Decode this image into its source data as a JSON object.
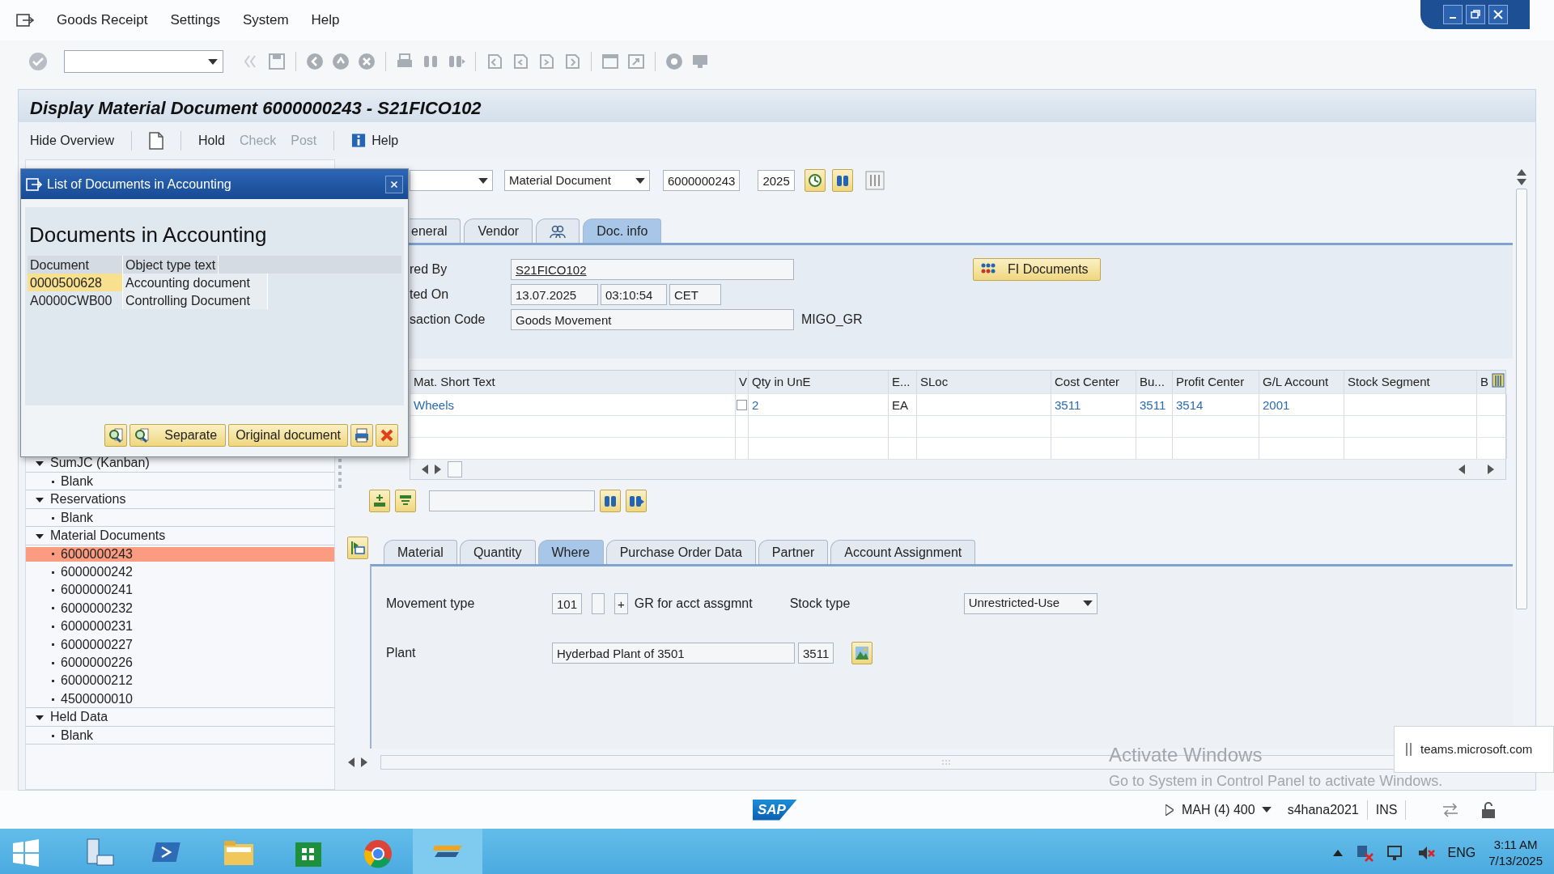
{
  "menu": [
    "Goods Receipt",
    "Settings",
    "System",
    "Help"
  ],
  "title": "Display Material Document 6000000243 - S21FICO102",
  "app_toolbar": [
    {
      "kind": "text",
      "label": "Hide Overview",
      "disabled": false
    },
    {
      "kind": "new_icon"
    },
    {
      "kind": "text",
      "label": "Hold",
      "disabled": false
    },
    {
      "kind": "text",
      "label": "Check",
      "disabled": true
    },
    {
      "kind": "text",
      "label": "Post",
      "disabled": true
    },
    {
      "kind": "info_text",
      "label": "Help",
      "disabled": false
    }
  ],
  "tree": [
    {
      "label": "SumJC (Kanban)",
      "expanded": true,
      "selected": false,
      "children": [
        {
          "label": "Blank",
          "selected": false
        }
      ]
    },
    {
      "label": "Reservations",
      "expanded": true,
      "selected": false,
      "children": [
        {
          "label": "Blank",
          "selected": false
        }
      ]
    },
    {
      "label": "Material Documents",
      "expanded": true,
      "selected": false,
      "children": [
        {
          "label": "6000000243",
          "selected": true
        },
        {
          "label": "6000000242",
          "selected": false
        },
        {
          "label": "6000000241",
          "selected": false
        },
        {
          "label": "6000000232",
          "selected": false
        },
        {
          "label": "6000000231",
          "selected": false
        },
        {
          "label": "6000000227",
          "selected": false
        },
        {
          "label": "6000000226",
          "selected": false
        },
        {
          "label": "6000000212",
          "selected": false
        },
        {
          "label": "4500000010",
          "selected": false
        }
      ]
    },
    {
      "label": "Held Data",
      "expanded": true,
      "selected": false,
      "children": [
        {
          "label": "Blank",
          "selected": false
        }
      ]
    }
  ],
  "header": {
    "doc_type": "Material Document",
    "doc_number": "6000000243",
    "year": "2025"
  },
  "header_tabs": [
    {
      "kind": "text",
      "label": "eneral",
      "selected": false
    },
    {
      "kind": "text",
      "label": "Vendor",
      "selected": false
    },
    {
      "kind": "partner_icon",
      "selected": false
    },
    {
      "kind": "text",
      "label": "Doc. info",
      "selected": true
    }
  ],
  "doc_info": {
    "rows": [
      {
        "label": "red By",
        "values": [
          "S21FICO102"
        ]
      },
      {
        "label": "ted On",
        "values": [
          "13.07.2025",
          "03:10:54",
          "CET"
        ]
      },
      {
        "label": "saction Code",
        "values": [
          "Goods Movement"
        ],
        "note": "MIGO_GR"
      }
    ],
    "fi_button": "FI Documents"
  },
  "items": {
    "columns": [
      "Mat. Short Text",
      "V",
      "Qty in UnE",
      "E...",
      "SLoc",
      "Cost Center",
      "Bu...",
      "Profit Center",
      "G/L Account",
      "Stock Segment",
      "B"
    ],
    "rows": [
      {
        "mat_short_text": "Wheels",
        "v_checked": false,
        "qty": "2",
        "unit": "EA",
        "cost_center": "3511",
        "business_area": "3511",
        "profit_center": "3514",
        "gl_account": "2001"
      }
    ]
  },
  "detail_tabs": [
    {
      "label": "Material",
      "selected": false
    },
    {
      "label": "Quantity",
      "selected": false
    },
    {
      "label": "Where",
      "selected": true
    },
    {
      "label": "Purchase Order Data",
      "selected": false
    },
    {
      "label": "Partner",
      "selected": false
    },
    {
      "label": "Account Assignment",
      "selected": false
    }
  ],
  "where": {
    "movement_label": "Movement type",
    "movement_type": "101",
    "movement_indicator": "+",
    "movement_text": "GR for acct assgmnt",
    "stock_type_label": "Stock type",
    "stock_type": "Unrestricted-Use",
    "plant_label": "Plant",
    "plant_name": "Hyderbad Plant of 3501",
    "plant": "3511"
  },
  "popup": {
    "title": "List of Documents in Accounting",
    "heading": "Documents in Accounting",
    "columns": [
      "Document",
      "Object type text"
    ],
    "rows": [
      {
        "document": "0000500628",
        "type_text": "Accounting document",
        "selected": true
      },
      {
        "document": "A0000CWB00",
        "type_text": "Controlling Document",
        "selected": false
      }
    ],
    "buttons": [
      {
        "kind": "detail_icon"
      },
      {
        "kind": "icon_text",
        "label": "Separate"
      },
      {
        "kind": "text",
        "label": "Original document"
      },
      {
        "kind": "print_icon"
      },
      {
        "kind": "cancel_icon"
      }
    ]
  },
  "status_bar": {
    "logo": "SAP",
    "system": "MAH (4) 400",
    "server": "s4hana2021",
    "mode": "INS"
  },
  "taskbar": {
    "language": "ENG",
    "time": "3:11 AM",
    "date": "7/13/2025"
  },
  "activation": {
    "title": "Activate Windows",
    "text": "Go to System in Control Panel to activate Windows."
  },
  "notification": {
    "text": "teams.microsoft.com"
  }
}
